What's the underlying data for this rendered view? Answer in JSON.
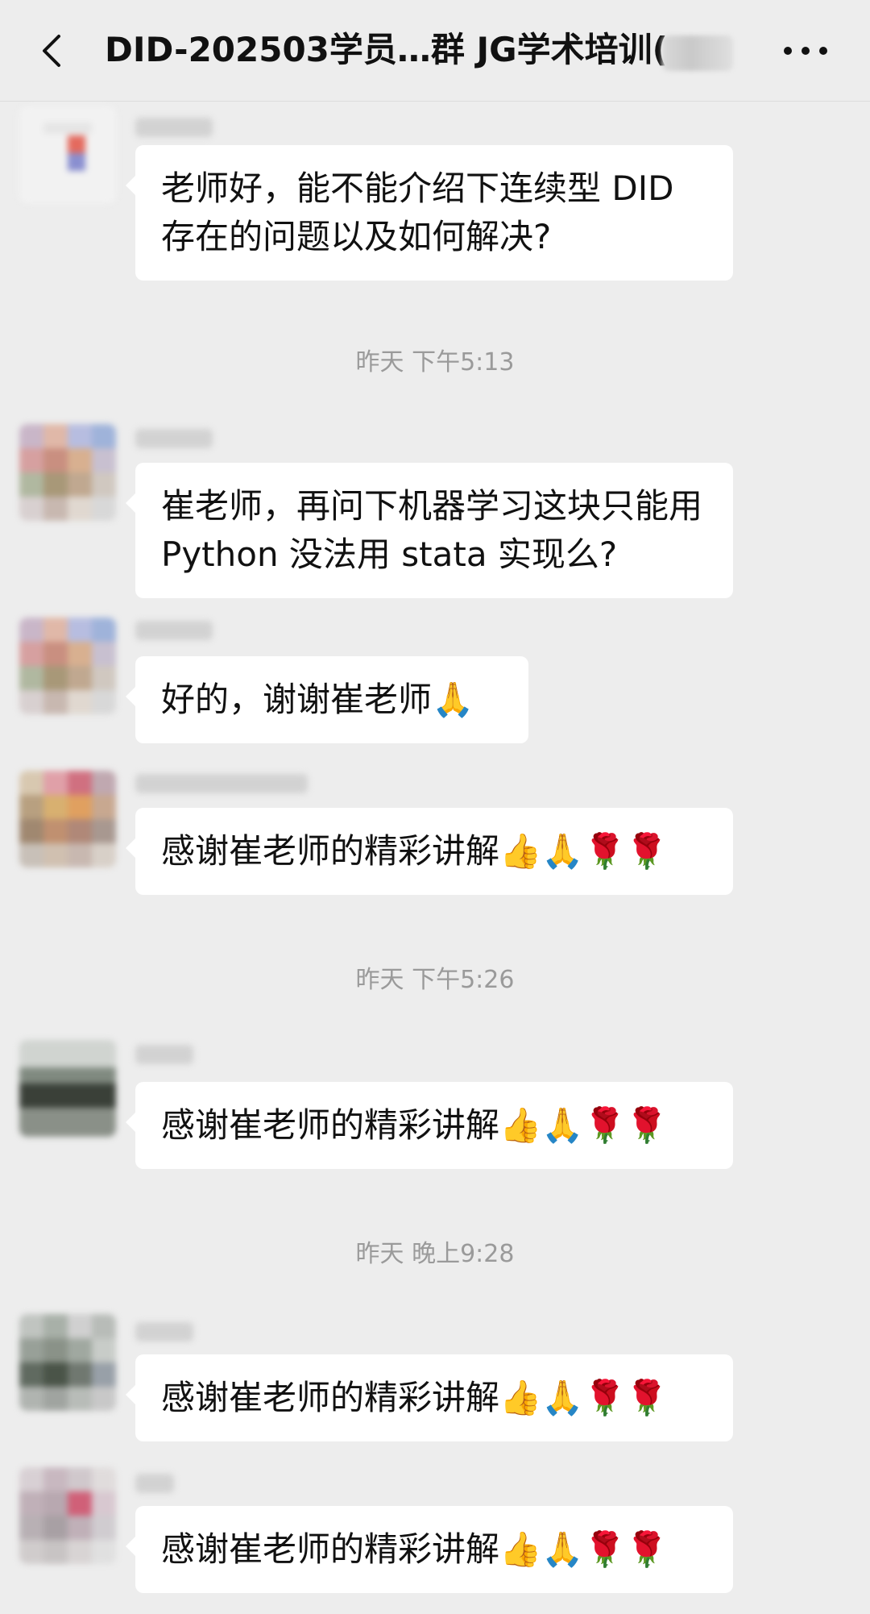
{
  "header": {
    "title": "DID-202503学员…群 JG学术培训("
  },
  "messages": [
    {
      "text": "老师好，能不能介绍下连续型 DID 存在的问题以及如何解决?"
    },
    {
      "timestamp": "昨天 下午5:13"
    },
    {
      "text": "崔老师，再问下机器学习这块只能用 Python 没法用 stata 实现么?"
    },
    {
      "text": "好的，谢谢崔老师🙏"
    },
    {
      "text": "感谢崔老师的精彩讲解👍🙏🌹🌹"
    },
    {
      "timestamp": "昨天 下午5:26"
    },
    {
      "text": "感谢崔老师的精彩讲解👍🙏🌹🌹"
    },
    {
      "timestamp": "昨天 晚上9:28"
    },
    {
      "text": "感谢崔老师的精彩讲解👍🙏🌹🌹"
    },
    {
      "text": "感谢崔老师的精彩讲解👍🙏🌹🌹"
    }
  ]
}
